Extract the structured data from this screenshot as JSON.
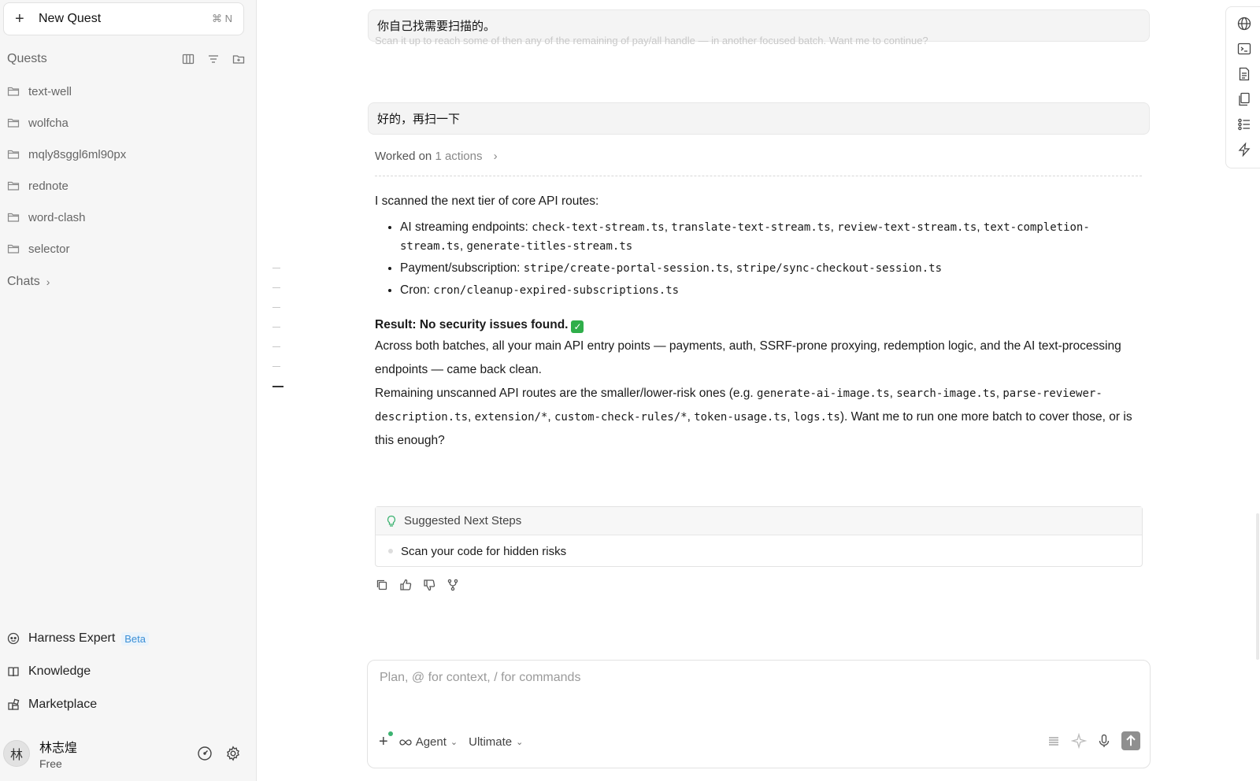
{
  "sidebar": {
    "new_quest": {
      "label": "New Quest",
      "shortcut": "⌘ N"
    },
    "quests_title": "Quests",
    "quests": [
      {
        "label": "text-well"
      },
      {
        "label": "wolfcha"
      },
      {
        "label": "mqly8sggl6ml90px"
      },
      {
        "label": "rednote"
      },
      {
        "label": "word-clash"
      },
      {
        "label": "selector"
      }
    ],
    "chats_title": "Chats",
    "bottom_nav": {
      "harness": {
        "label": "Harness Expert",
        "badge": "Beta"
      },
      "knowledge": {
        "label": "Knowledge"
      },
      "marketplace": {
        "label": "Marketplace"
      }
    },
    "user": {
      "avatar_char": "林",
      "name": "林志煌",
      "plan": "Free"
    }
  },
  "conversation": {
    "prev_user_msg": "你自己找需要扫描的。",
    "faded_text": "Scan it up to reach some of then any of the remaining of pay/all handle — in another focused batch. Want me to continue?",
    "user_msg": "好的，再扫一下",
    "worked": {
      "prefix": "Worked on",
      "count": "1 actions"
    },
    "intro": "I scanned the next tier of core API routes:",
    "bullets": {
      "ai": {
        "label": "AI streaming endpoints: ",
        "files": [
          "check-text-stream.ts",
          "translate-text-stream.ts",
          "review-text-stream.ts",
          "text-completion-stream.ts",
          "generate-titles-stream.ts"
        ]
      },
      "payment": {
        "label": "Payment/subscription: ",
        "files": [
          "stripe/create-portal-session.ts",
          "stripe/sync-checkout-session.ts"
        ]
      },
      "cron": {
        "label": "Cron: ",
        "files": [
          "cron/cleanup-expired-subscriptions.ts"
        ]
      }
    },
    "result": "Result: No security issues found.",
    "result_check": "✓",
    "para1": "Across both batches, all your main API entry points — payments, auth, SSRF-prone proxying, redemption logic, and the AI text-processing endpoints — came back clean.",
    "para2": {
      "before": "Remaining unscanned API routes are the smaller/lower-risk ones (e.g. ",
      "files": [
        "generate-ai-image.ts",
        "search-image.ts",
        "parse-reviewer-description.ts",
        "extension/*",
        "custom-check-rules/*",
        "token-usage.ts",
        "logs.ts"
      ],
      "after": "). Want me to run one more batch to cover those, or is this enough?"
    },
    "next_steps": {
      "title": "Suggested Next Steps",
      "items": [
        "Scan your code for hidden risks"
      ]
    }
  },
  "composer": {
    "placeholder": "Plan, @ for context, / for commands",
    "mode": "Agent",
    "model": "Ultimate"
  },
  "colors": {
    "accent_green": "#2fae4a",
    "beta_blue": "#3b8fd6"
  }
}
